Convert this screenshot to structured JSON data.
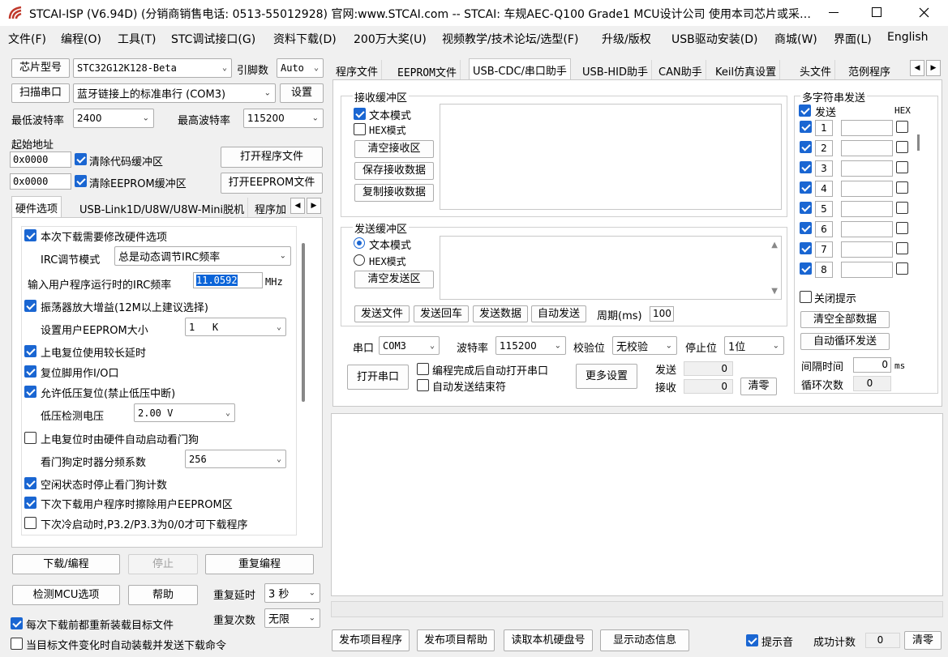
{
  "window": {
    "title": "STCAI-ISP (V6.94D) (分销商销售电话: 0513-55012928) 官网:www.STCAI.com  -- STCAI: 车规AEC-Q100 Grade1 MCU设计公司 使用本司芯片或采…"
  },
  "menu": [
    "文件(F)",
    "编程(O)",
    "工具(T)",
    "STC调试接口(G)",
    "资料下载(D)",
    "200万大奖(U)",
    "视频教学/技术论坛/选型(F)",
    "升级/版权",
    "USB驱动安装(D)",
    "商城(W)",
    "界面(L)",
    "English"
  ],
  "left": {
    "chip_btn": "芯片型号",
    "chip": "STC32G12K128-Beta",
    "pins_label": "引脚数",
    "pins": "Auto",
    "scan_btn": "扫描串口",
    "port": "蓝牙链接上的标准串行 (COM3)",
    "settings_btn": "设置",
    "min_baud_label": "最低波特率",
    "min_baud": "2400",
    "max_baud_label": "最高波特率",
    "max_baud": "115200",
    "start_addr_label": "起始地址",
    "addr1": "0x0000",
    "clear_code": "清除代码缓冲区",
    "open_prog": "打开程序文件",
    "addr2": "0x0000",
    "clear_eeprom": "清除EEPROM缓冲区",
    "open_eeprom": "打开EEPROM文件",
    "tabs": [
      "硬件选项",
      "USB-Link1D/U8W/U8W-Mini脱机",
      "程序加"
    ],
    "hw": {
      "modify": "本次下载需要修改硬件选项",
      "irc_mode_label": "IRC调节模式",
      "irc_mode": "总是动态调节IRC频率",
      "irc_freq_label": "输入用户程序运行时的IRC频率",
      "irc_freq": "11.0592",
      "mhz": "MHz",
      "osc_gain": "振荡器放大增益(12M以上建议选择)",
      "eeprom_size_label": "设置用户EEPROM大小",
      "eeprom_size": "1   K",
      "long_delay": "上电复位使用较长延时",
      "reset_io": "复位脚用作I/O口",
      "lvr": "允许低压复位(禁止低压中断)",
      "lvd_label": "低压检测电压",
      "lvd": "2.00 V",
      "wdt_hw": "上电复位时由硬件自动启动看门狗",
      "wdt_div_label": "看门狗定时器分频系数",
      "wdt_div": "256",
      "idle_wdt": "空闲状态时停止看门狗计数",
      "erase_eeprom": "下次下载用户程序时擦除用户EEPROM区",
      "cold_boot": "下次冷启动时,P3.2/P3.3为0/0才可下载程序"
    },
    "download_btn": "下载/编程",
    "stop_btn": "停止",
    "reprog_btn": "重复编程",
    "detect_btn": "检测MCU选项",
    "help_btn": "帮助",
    "repeat_delay_label": "重复延时",
    "repeat_delay": "3 秒",
    "repeat_count_label": "重复次数",
    "repeat_count": "无限",
    "reload_each": "每次下载前都重新装载目标文件",
    "auto_reload": "当目标文件变化时自动装载并发送下载命令"
  },
  "right": {
    "tabs": [
      "程序文件",
      "EEPROM文件",
      "USB-CDC/串口助手",
      "USB-HID助手",
      "CAN助手",
      "Keil仿真设置",
      "头文件",
      "范例程序"
    ],
    "recv": {
      "title": "接收缓冲区",
      "text_mode": "文本模式",
      "hex_mode": "HEX模式",
      "clear": "清空接收区",
      "save": "保存接收数据",
      "copy": "复制接收数据"
    },
    "send": {
      "title": "发送缓冲区",
      "text_mode": "文本模式",
      "hex_mode": "HEX模式",
      "clear": "清空发送区",
      "send_file": "发送文件",
      "send_enter": "发送回车",
      "send_data": "发送数据",
      "auto_send": "自动发送",
      "period_label": "周期(ms)",
      "period": "100"
    },
    "multi": {
      "title": "多字符串发送",
      "send": "发送",
      "hex": "HEX",
      "rows": [
        "1",
        "2",
        "3",
        "4",
        "5",
        "6",
        "7",
        "8"
      ],
      "close_tip": "关闭提示",
      "clear_all": "清空全部数据",
      "auto_loop": "自动循环发送",
      "interval_label": "间隔时间",
      "interval": "0",
      "ms": "ms",
      "loop_count_label": "循环次数",
      "loop_count": "0"
    },
    "serial": {
      "port_label": "串口",
      "port": "COM3",
      "baud_label": "波特率",
      "baud": "115200",
      "parity_label": "校验位",
      "parity": "无校验",
      "stop_label": "停止位",
      "stop": "1位",
      "open_btn": "打开串口",
      "auto_open": "编程完成后自动打开串口",
      "auto_end": "自动发送结束符",
      "more_btn": "更多设置",
      "tx_label": "发送",
      "tx": "0",
      "rx_label": "接收",
      "rx": "0",
      "clear_btn": "清零"
    },
    "bottom": {
      "publish_prog": "发布项目程序",
      "publish_help": "发布项目帮助",
      "read_disk": "读取本机硬盘号",
      "show_info": "显示动态信息",
      "sound": "提示音",
      "success_label": "成功计数",
      "success": "0",
      "clear": "清零"
    }
  }
}
